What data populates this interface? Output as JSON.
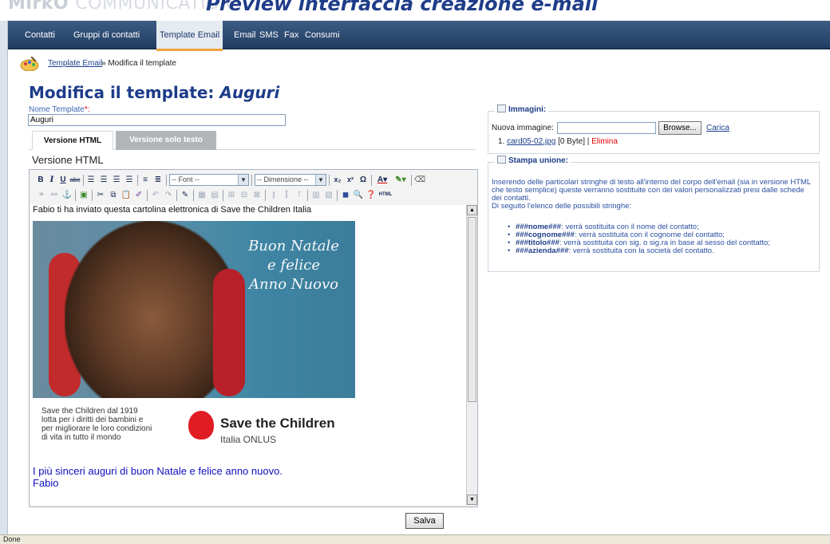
{
  "header": {
    "logo_prefix": "MirkO",
    "logo_suffix": "COMMUNICATION",
    "caption": "Preview interfaccia creazione e-mail"
  },
  "nav": {
    "items": [
      "Contatti",
      "Gruppi di contatti",
      "Template Email",
      "Email",
      "SMS",
      "Fax",
      "Consumi"
    ],
    "active": "Template Email"
  },
  "breadcrumb": {
    "link": "Template Email",
    "rest": "» Modifica il template"
  },
  "page": {
    "title_prefix": "Modifica il template:",
    "title_name": "Auguri",
    "name_label": "Nome Template",
    "name_required": "*:",
    "name_value": "Auguri"
  },
  "tabs": {
    "html": "Versione HTML",
    "text": "Versione solo testo"
  },
  "editor": {
    "title": "Versione HTML",
    "font_select": "-- Font --",
    "size_select": "-- Dimensione --",
    "intro": "Fabio ti ha inviato questa cartolina elettronica di Save the Children Italia",
    "card_wish": [
      "Buon Natale",
      "e felice",
      "Anno Nuovo"
    ],
    "stc_text": [
      "Save the Children dal 1919",
      "lotta per i diritti dei bambini e",
      "per migliorare le loro condizioni",
      "di vita in tutto il mondo"
    ],
    "stc_logo_name": "Save the Children",
    "stc_logo_sub": "Italia ONLUS",
    "greeting": [
      "I più sinceri auguri di buon Natale e felice anno nuovo.",
      "Fabio"
    ]
  },
  "actions": {
    "save": "Salva"
  },
  "images_panel": {
    "title": "Immagini:",
    "new_label": "Nuova immagine:",
    "browse": "Browse...",
    "upload": "Carica",
    "file_index": "1.",
    "file_name": "card05-02.jpg",
    "file_size": "[0 Byte] |",
    "delete": "Elimina"
  },
  "merge_panel": {
    "title": "Stampa unione:",
    "intro": "Inserendo delle particolari stringhe di testo all'interno del corpo dell'email (sia in versione HTML che testo semplice) queste verranno sostituite con dei valori personalizzati presi dalle schede dei contatti.",
    "intro2": "Di seguito l'elenco delle possibili stringhe:",
    "items": [
      {
        "tag": "###nome###",
        "desc": ": verrà sostituita con il nome del contatto;"
      },
      {
        "tag": "###cognome###",
        "desc": ": verrà sostituita con il cognome del contatto;"
      },
      {
        "tag": "###titolo###",
        "desc": ": verrà sostituita con sig. o sig.ra in base al sesso del conttatto;"
      },
      {
        "tag": "###azienda###",
        "desc": ": verrà sostituita con la società del contatto."
      }
    ]
  },
  "statusbar": {
    "text": "Done"
  }
}
